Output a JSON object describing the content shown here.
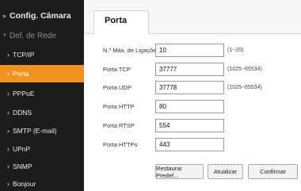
{
  "sidebar": {
    "section_title": "Config. Câmara",
    "group_title": "Def. de Rede",
    "items": [
      {
        "label": "TCP/IP"
      },
      {
        "label": "Porta"
      },
      {
        "label": "PPPoE"
      },
      {
        "label": "DDNS"
      },
      {
        "label": "SMTP (E-mail)"
      },
      {
        "label": "UPnP"
      },
      {
        "label": "SNMP"
      },
      {
        "label": "Bonjour"
      }
    ],
    "active_index": 1
  },
  "tab": {
    "label": "Porta"
  },
  "form": {
    "max_connections": {
      "label": "N.º Máx. de Ligações",
      "value": "10",
      "hint": "(1~20)"
    },
    "tcp_port": {
      "label": "Porta TCP",
      "value": "37777",
      "hint": "(1025~65534)"
    },
    "udp_port": {
      "label": "Porta UDP",
      "value": "37778",
      "hint": "(1025~65534)"
    },
    "http_port": {
      "label": "Porta HTTP",
      "value": "80"
    },
    "rtsp_port": {
      "label": "Porta RTSP",
      "value": "554"
    },
    "https_port": {
      "label": "Porta HTTPs",
      "value": "443"
    }
  },
  "buttons": {
    "restore": "Restaurar Predef...",
    "refresh": "Atualizar",
    "confirm": "Confirmar"
  },
  "colors": {
    "sidebar_bg": "#1c1c1c",
    "active_bg": "#f0941f"
  }
}
